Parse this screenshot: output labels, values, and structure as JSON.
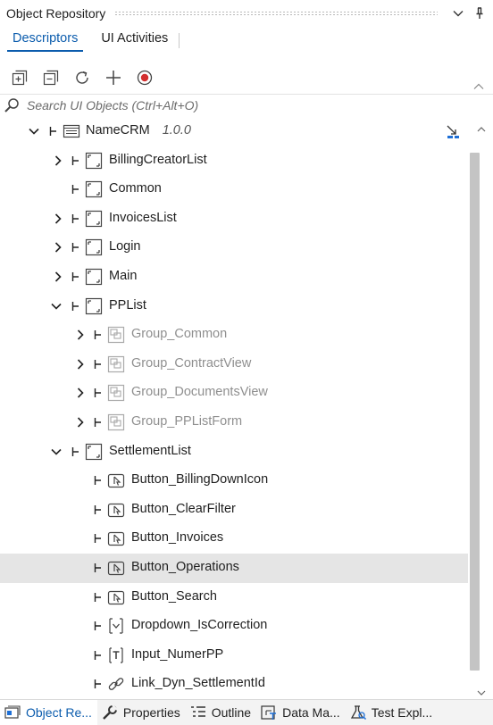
{
  "panel": {
    "title": "Object Repository"
  },
  "tabs": [
    {
      "label": "Descriptors",
      "active": true
    },
    {
      "label": "UI Activities",
      "active": false
    }
  ],
  "toolbar": {
    "icons": [
      "expand-all-icon",
      "collapse-all-icon",
      "refresh-icon",
      "add-icon",
      "record-icon"
    ]
  },
  "search": {
    "placeholder": "Search UI Objects (Ctrl+Alt+O)"
  },
  "tree": {
    "root": {
      "label": "NameCRM",
      "version": "1.0.0"
    },
    "items": [
      {
        "label": "BillingCreatorList",
        "type": "screen",
        "expander": "collapsed"
      },
      {
        "label": "Common",
        "type": "screen",
        "expander": "none"
      },
      {
        "label": "InvoicesList",
        "type": "screen",
        "expander": "collapsed"
      },
      {
        "label": "Login",
        "type": "screen",
        "expander": "collapsed"
      },
      {
        "label": "Main",
        "type": "screen",
        "expander": "collapsed"
      },
      {
        "label": "PPList",
        "type": "screen",
        "expander": "expanded"
      },
      {
        "label": "Group_Common",
        "type": "group",
        "expander": "collapsed"
      },
      {
        "label": "Group_ContractView",
        "type": "group",
        "expander": "collapsed"
      },
      {
        "label": "Group_DocumentsView",
        "type": "group",
        "expander": "collapsed"
      },
      {
        "label": "Group_PPListForm",
        "type": "group",
        "expander": "collapsed"
      },
      {
        "label": "SettlementList",
        "type": "screen",
        "expander": "expanded"
      },
      {
        "label": "Button_BillingDownIcon",
        "type": "button"
      },
      {
        "label": "Button_ClearFilter",
        "type": "button"
      },
      {
        "label": "Button_Invoices",
        "type": "button"
      },
      {
        "label": "Button_Operations",
        "type": "button",
        "selected": true
      },
      {
        "label": "Button_Search",
        "type": "button"
      },
      {
        "label": "Dropdown_IsCorrection",
        "type": "dropdown"
      },
      {
        "label": "Input_NumerPP",
        "type": "input"
      },
      {
        "label": "Link_Dyn_SettlementId",
        "type": "link"
      }
    ]
  },
  "bottom_tabs": [
    {
      "label": "Object Re...",
      "icon": "object-repository-icon",
      "active": true
    },
    {
      "label": "Properties",
      "icon": "wrench-icon",
      "active": false
    },
    {
      "label": "Outline",
      "icon": "outline-icon",
      "active": false
    },
    {
      "label": "Data Ma...",
      "icon": "data-manager-icon",
      "active": false
    },
    {
      "label": "Test Expl...",
      "icon": "test-explorer-icon",
      "active": false
    }
  ],
  "colors": {
    "accent": "#0b5cad",
    "record": "#d32f2f",
    "selected_row": "#e5e5e5"
  }
}
